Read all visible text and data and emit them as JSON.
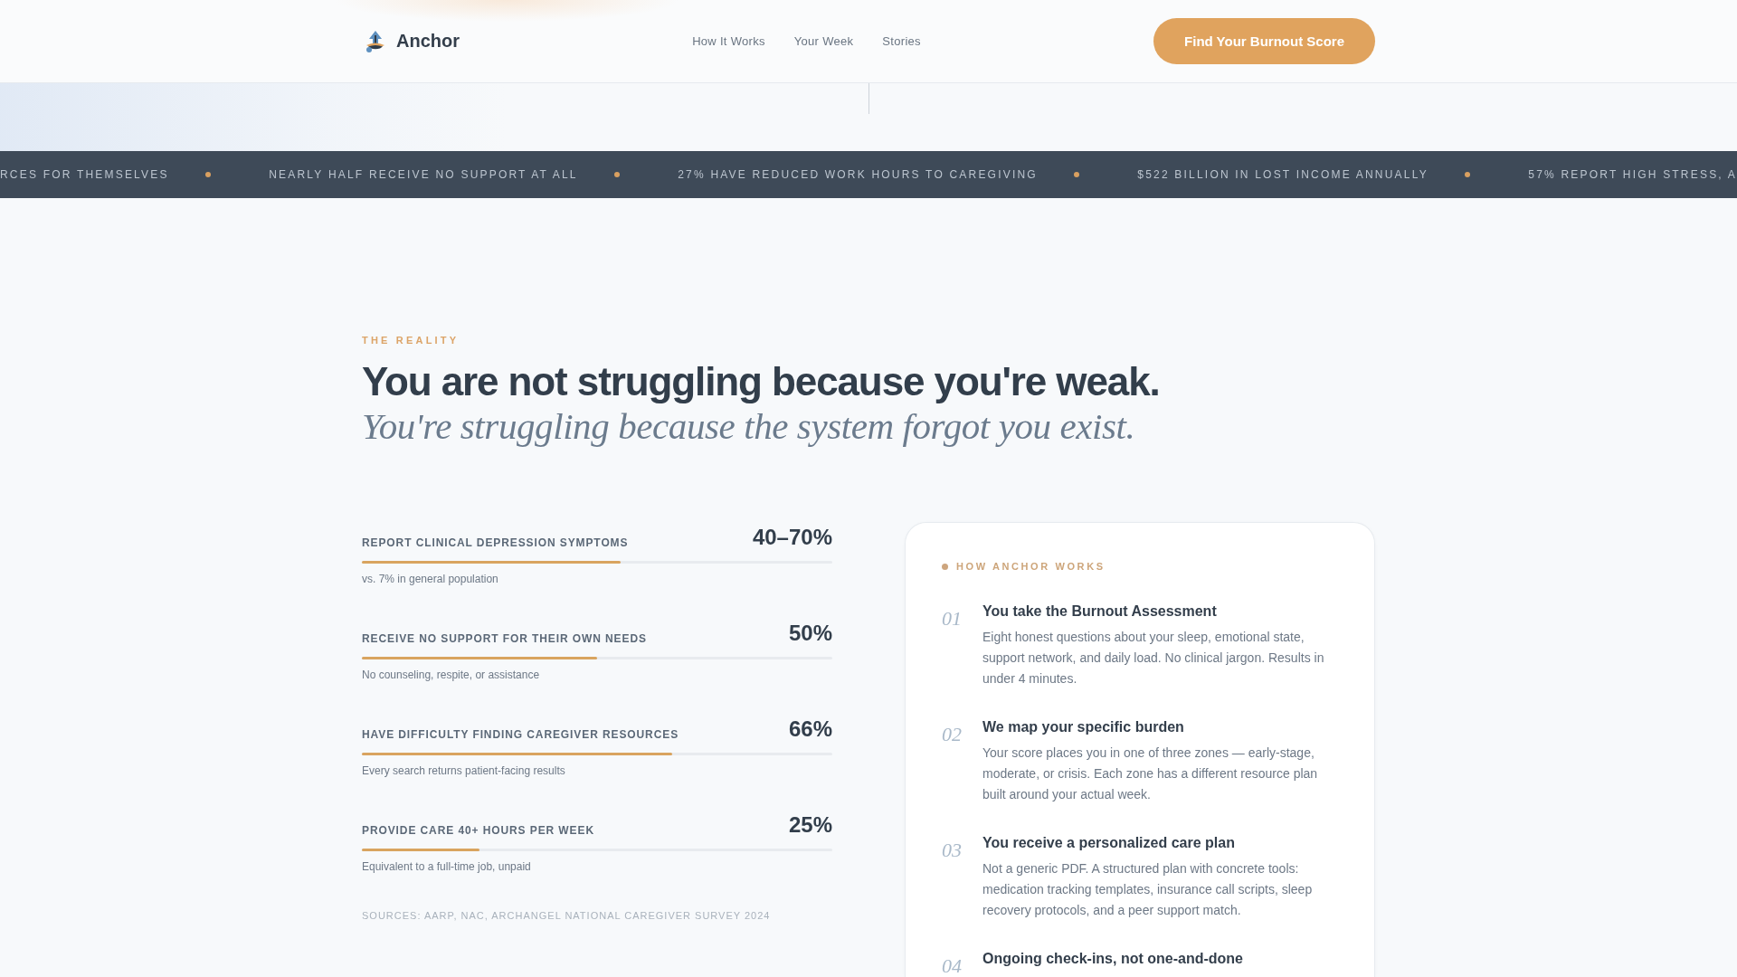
{
  "header": {
    "brand": "Anchor",
    "nav": [
      "How It Works",
      "Your Week",
      "Stories"
    ],
    "cta": "Find Your Burnout Score"
  },
  "ticker": {
    "items": [
      "RCES FOR THEMSELVES",
      "NEARLY HALF RECEIVE NO SUPPORT AT ALL",
      "27% HAVE REDUCED WORK HOURS TO CAREGIVING",
      "$522 BILLION IN LOST INCOME ANNUALLY",
      "57% REPORT HIGH STRESS, A"
    ]
  },
  "reality": {
    "eyebrow": "THE REALITY",
    "headline": "You are not struggling because you're weak.",
    "subheadline": "You're struggling because the system forgot you exist.",
    "stats": [
      {
        "label": "REPORT CLINICAL DEPRESSION SYMPTOMS",
        "value": "40–70%",
        "level": 0.55,
        "note": "vs. 7% in general population"
      },
      {
        "label": "RECEIVE NO SUPPORT FOR THEIR OWN NEEDS",
        "value": "50%",
        "level": 0.5,
        "note": "No counseling, respite, or assistance"
      },
      {
        "label": "HAVE DIFFICULTY FINDING CAREGIVER RESOURCES",
        "value": "66%",
        "level": 0.66,
        "note": "Every search returns patient-facing results"
      },
      {
        "label": "PROVIDE CARE 40+ HOURS PER WEEK",
        "value": "25%",
        "level": 0.25,
        "note": "Equivalent to a full-time job, unpaid"
      }
    ],
    "sources": "SOURCES: AARP, NAC, ARCHANGEL NATIONAL CAREGIVER SURVEY 2024"
  },
  "how_it_works": {
    "title": "HOW ANCHOR WORKS",
    "steps": [
      {
        "number": "01",
        "title": "You take the Burnout Assessment",
        "description": "Eight honest questions about your sleep, emotional state, support network, and daily load. No clinical jargon. Results in under 4 minutes."
      },
      {
        "number": "02",
        "title": "We map your specific burden",
        "description": "Your score places you in one of three zones — early-stage, moderate, or crisis. Each zone has a different resource plan built around your actual week."
      },
      {
        "number": "03",
        "title": "You receive a personalized care plan",
        "description": "Not a generic PDF. A structured plan with concrete tools: medication tracking templates, insurance call scripts, sleep recovery protocols, and a peer support match."
      },
      {
        "number": "04",
        "title": "Ongoing check-ins, not one-and-done"
      }
    ]
  }
}
